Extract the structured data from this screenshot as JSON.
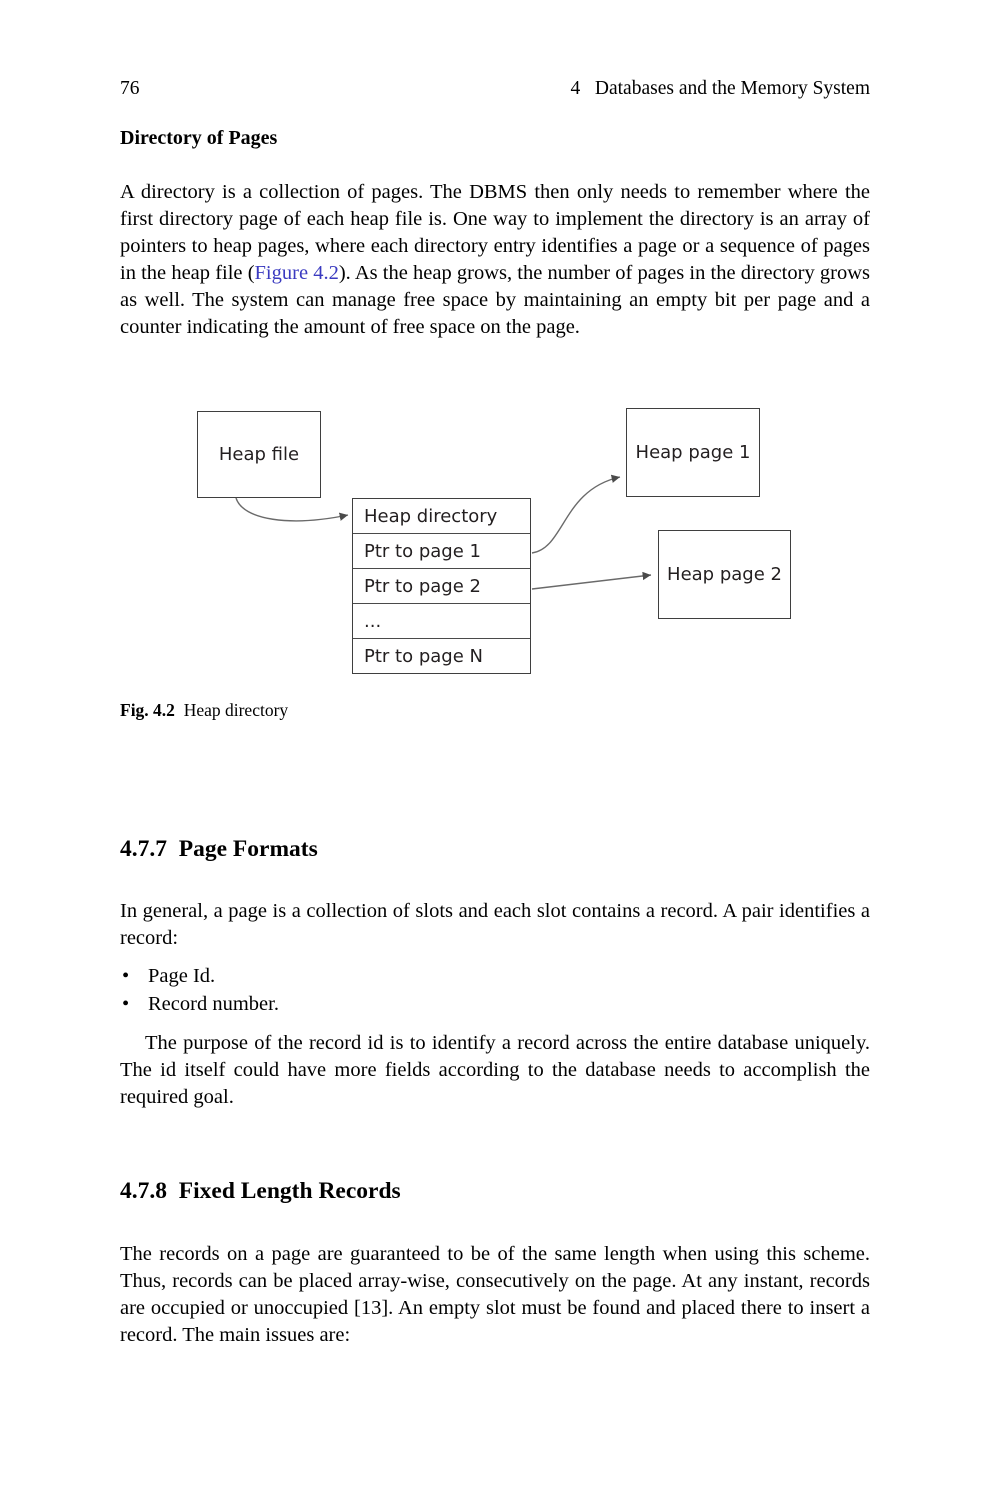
{
  "page": {
    "folio": "76",
    "chapter_line": "4   Databases and the Memory System"
  },
  "subheading": "Directory of Pages",
  "paragraphs": {
    "directory_intro_a": "A directory is a collection of pages. The DBMS then only needs to remember where the first directory page of each heap file is. One way to implement the directory is an array of pointers to heap pages, where each directory entry identifies a page or a sequence of pages in the heap file (",
    "directory_link": "Figure 4.2",
    "directory_intro_b": "). As the heap grows, the number of pages in the directory grows as well. The system can manage free space by maintaining an empty bit per page and a counter indicating the amount of free space on the page.",
    "page_formats_intro": "In general, a page is a collection of slots and each slot contains a record. A pair identifies a record:",
    "record_id_purpose": "The purpose of the record id is to identify a record across the entire database uniquely. The id itself could have more fields according to the database needs to accomplish the required goal.",
    "fixed_length_intro": "The records on a page are guaranteed to be of the same length when using this scheme. Thus, records can be placed array-wise, consecutively on the page. At any instant, records are occupied or unoccupied [13]. An empty slot must be found and placed there to insert a record. The main issues are:"
  },
  "bullets": [
    {
      "marker": "•",
      "text": "Page Id."
    },
    {
      "marker": "•",
      "text": "Record number."
    }
  ],
  "sections": [
    {
      "number": "4.7.7",
      "title": "Page Formats",
      "heading": "4.7.7  Page Formats"
    },
    {
      "number": "4.7.8",
      "title": "Fixed Length Records",
      "heading": "4.7.8  Fixed Length Records"
    }
  ],
  "figure": {
    "caption_label": "Fig. 4.2",
    "caption_text": "Heap directory",
    "caption_full": "Fig. 4.2  Heap directory",
    "boxes": {
      "heap_file": "Heap file",
      "heap_page_1": "Heap page 1",
      "heap_page_2": "Heap page 2"
    },
    "directory_rows": [
      "Heap directory",
      "Ptr to page 1",
      "Ptr to page 2",
      "...",
      "Ptr to page N"
    ],
    "colors": {
      "box_border": "#3f3f3f",
      "row_divider": "#4a4a4a",
      "arrow": "#555555",
      "text": "#231f20"
    }
  },
  "colors": {
    "page_background": "#ffffff",
    "body_text": "#000000",
    "link": "#3a3ac0"
  }
}
